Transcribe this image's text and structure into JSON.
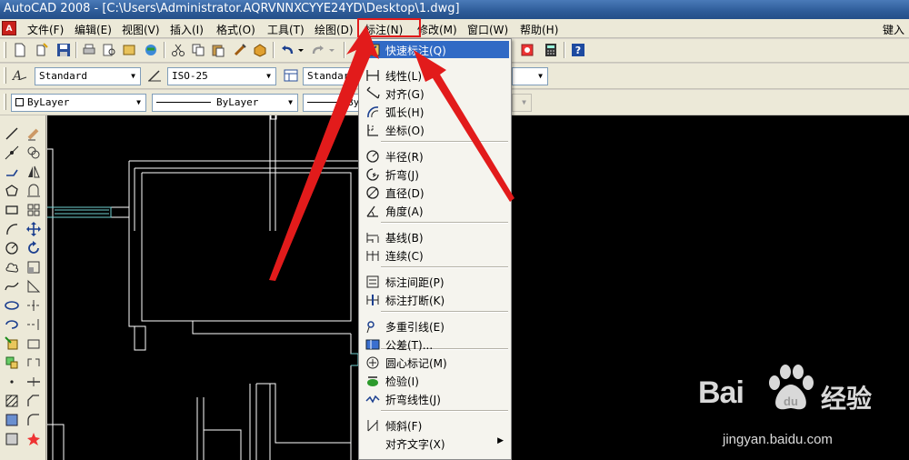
{
  "window": {
    "title": "AutoCAD 2008 - [C:\\Users\\Administrator.AQRVNNXCYYE24YD\\Desktop\\1.dwg]",
    "app_icon_label": "A"
  },
  "menubar": {
    "items": [
      "文件(F)",
      "编辑(E)",
      "视图(V)",
      "插入(I)",
      "格式(O)",
      "工具(T)",
      "绘图(D)",
      "标注(N)",
      "修改(M)",
      "窗口(W)",
      "帮助(H)"
    ],
    "right_hint": "键入"
  },
  "toolbar_styles": {
    "text_style": "Standard",
    "dim_style": "ISO-25",
    "table_style": "Standard"
  },
  "toolbar_layers": {
    "color": "ByLayer",
    "linetype": "ByLayer",
    "lineweight": "ByLayer"
  },
  "dimension_menu": {
    "items": [
      {
        "label": "快速标注(Q)",
        "icon": "quick-dimension-icon",
        "highlighted": true
      },
      {
        "label": "线性(L)",
        "icon": "linear-dimension-icon"
      },
      {
        "label": "对齐(G)",
        "icon": "aligned-dimension-icon"
      },
      {
        "label": "弧长(H)",
        "icon": "arc-length-icon"
      },
      {
        "label": "坐标(O)",
        "icon": "ordinate-icon"
      },
      {
        "label": "半径(R)",
        "icon": "radius-icon"
      },
      {
        "label": "折弯(J)",
        "icon": "jogged-icon"
      },
      {
        "label": "直径(D)",
        "icon": "diameter-icon"
      },
      {
        "label": "角度(A)",
        "icon": "angular-icon"
      },
      {
        "label": "基线(B)",
        "icon": "baseline-icon"
      },
      {
        "label": "连续(C)",
        "icon": "continue-icon"
      },
      {
        "label": "标注间距(P)",
        "icon": "dimension-space-icon"
      },
      {
        "label": "标注打断(K)",
        "icon": "dimension-break-icon"
      },
      {
        "label": "多重引线(E)",
        "icon": "multileader-icon"
      },
      {
        "label": "公差(T)...",
        "icon": "tolerance-icon"
      },
      {
        "label": "圆心标记(M)",
        "icon": "center-mark-icon"
      },
      {
        "label": "检验(I)",
        "icon": "inspection-icon"
      },
      {
        "label": "折弯线性(J)",
        "icon": "jogged-linear-icon"
      },
      {
        "label": "倾斜(F)",
        "icon": "oblique-icon"
      },
      {
        "label": "对齐文字(X)",
        "icon": "",
        "submenu": true
      }
    ]
  },
  "watermark": {
    "brand": "Bai",
    "brand2": "经验",
    "url": "jingyan.baidu.com"
  },
  "colors": {
    "highlight": "#316ac5",
    "annotation_red": "#e21b1b",
    "canvas": "#000000"
  }
}
